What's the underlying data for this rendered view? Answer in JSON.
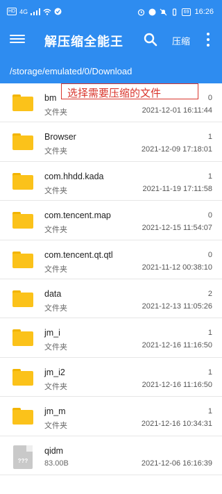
{
  "status_bar": {
    "hd": "HD",
    "signal": "4G",
    "battery": "69",
    "time": "16:26"
  },
  "toolbar": {
    "title": "解压缩全能王",
    "compress_label": "压缩",
    "icons": [
      "menu-icon",
      "search-icon",
      "more-vert-icon"
    ]
  },
  "path": "/storage/emulated/0/Download",
  "annotation": "选择需要压缩的文件",
  "colors": {
    "primary": "#2e8cf0",
    "folder": "#fbc21a",
    "annotation": "#d9342b"
  },
  "files": [
    {
      "name": "bm",
      "type": "文件夹",
      "count": "0",
      "date": "2021-12-01 16:11:44",
      "icon": "folder-icon"
    },
    {
      "name": "Browser",
      "type": "文件夹",
      "count": "1",
      "date": "2021-12-09 17:18:01",
      "icon": "folder-icon"
    },
    {
      "name": "com.hhdd.kada",
      "type": "文件夹",
      "count": "1",
      "date": "2021-11-19 17:11:58",
      "icon": "folder-icon"
    },
    {
      "name": "com.tencent.map",
      "type": "文件夹",
      "count": "0",
      "date": "2021-12-15 11:54:07",
      "icon": "folder-icon"
    },
    {
      "name": "com.tencent.qt.qtl",
      "type": "文件夹",
      "count": "0",
      "date": "2021-11-12 00:38:10",
      "icon": "folder-icon"
    },
    {
      "name": "data",
      "type": "文件夹",
      "count": "2",
      "date": "2021-12-13 11:05:26",
      "icon": "folder-icon"
    },
    {
      "name": "jm_i",
      "type": "文件夹",
      "count": "1",
      "date": "2021-12-16 11:16:50",
      "icon": "folder-icon"
    },
    {
      "name": "jm_i2",
      "type": "文件夹",
      "count": "1",
      "date": "2021-12-16 11:16:50",
      "icon": "folder-icon"
    },
    {
      "name": "jm_m",
      "type": "文件夹",
      "count": "1",
      "date": "2021-12-16 10:34:31",
      "icon": "folder-icon"
    },
    {
      "name": "qidm",
      "type": "83.00B",
      "count": "",
      "date": "2021-12-06 16:16:39",
      "icon": "unknown-file-icon",
      "icon_text": "???"
    }
  ]
}
